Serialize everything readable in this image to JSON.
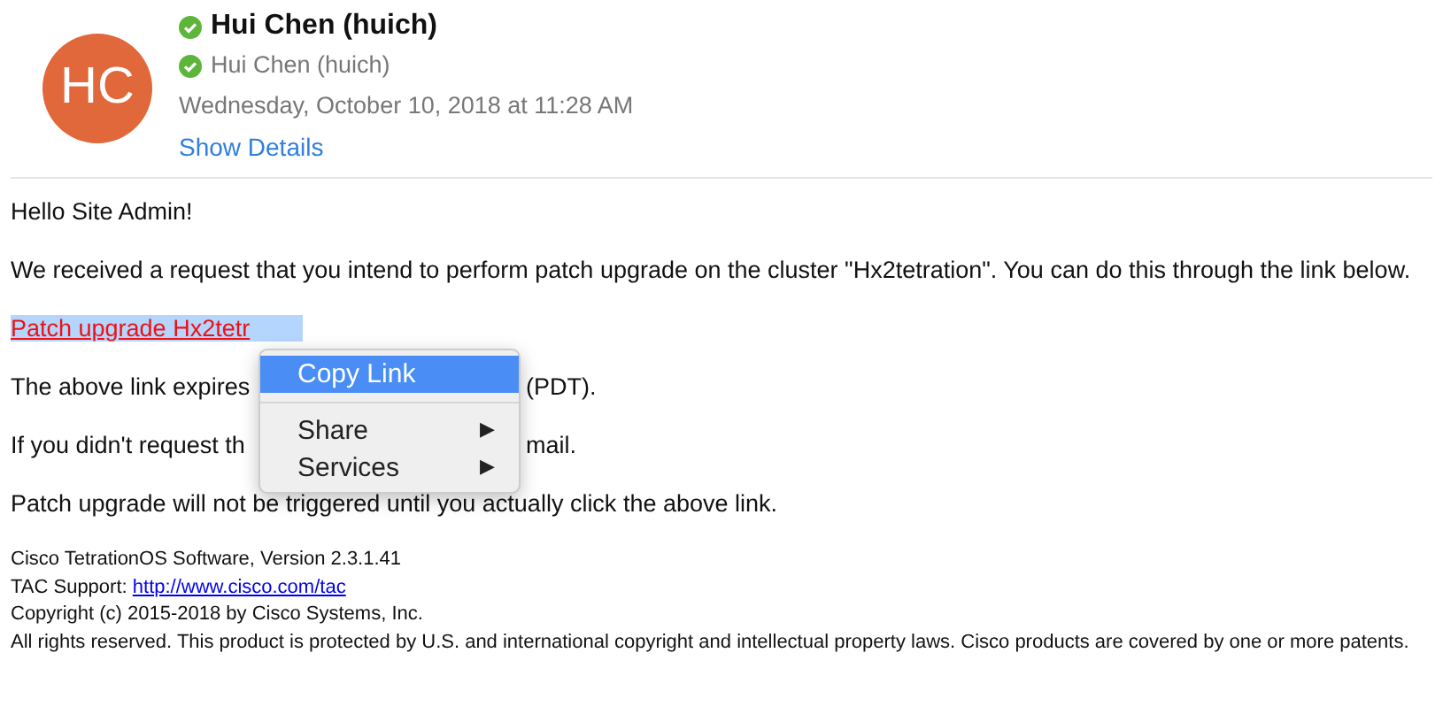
{
  "header": {
    "avatar_initials": "HC",
    "sender": {
      "name": "Hui Chen (huich)",
      "verified": true
    },
    "recipient": {
      "name": "Hui Chen (huich)",
      "verified": true
    },
    "date": "Wednesday, October 10, 2018 at 11:28 AM",
    "show_details": "Show Details"
  },
  "body": {
    "greeting": "Hello Site Admin!",
    "paragraph": "We received a request that you intend to perform patch upgrade on the cluster \"Hx2tetration\". You can do this through the link below.",
    "link": {
      "text": "Patch upgrade Hx2tetr",
      "selected": true
    },
    "partial_lines": [
      {
        "left": "The above link expires",
        "right": "(PDT)."
      },
      {
        "left": "If you didn't request th",
        "right": "mail."
      }
    ],
    "closing": "Patch upgrade will not be triggered until you actually click the above link."
  },
  "footer": {
    "version": "Cisco TetrationOS Software, Version 2.3.1.41",
    "support_label": "TAC Support:",
    "support_link": "http://www.cisco.com/tac",
    "copyright": "Copyright (c) 2015-2018 by Cisco Systems, Inc.",
    "rights": "All rights reserved. This product is protected by U.S. and international copyright and intellectual property laws. Cisco products are covered by one or more patents."
  },
  "context_menu": [
    {
      "kind": "item",
      "label": "Copy Link",
      "selected": true
    },
    {
      "kind": "separator"
    },
    {
      "kind": "submenu",
      "label": "Share",
      "arrow": "▶",
      "selected": false
    },
    {
      "kind": "submenu",
      "label": "Services",
      "arrow": "▶",
      "selected": false
    }
  ]
}
